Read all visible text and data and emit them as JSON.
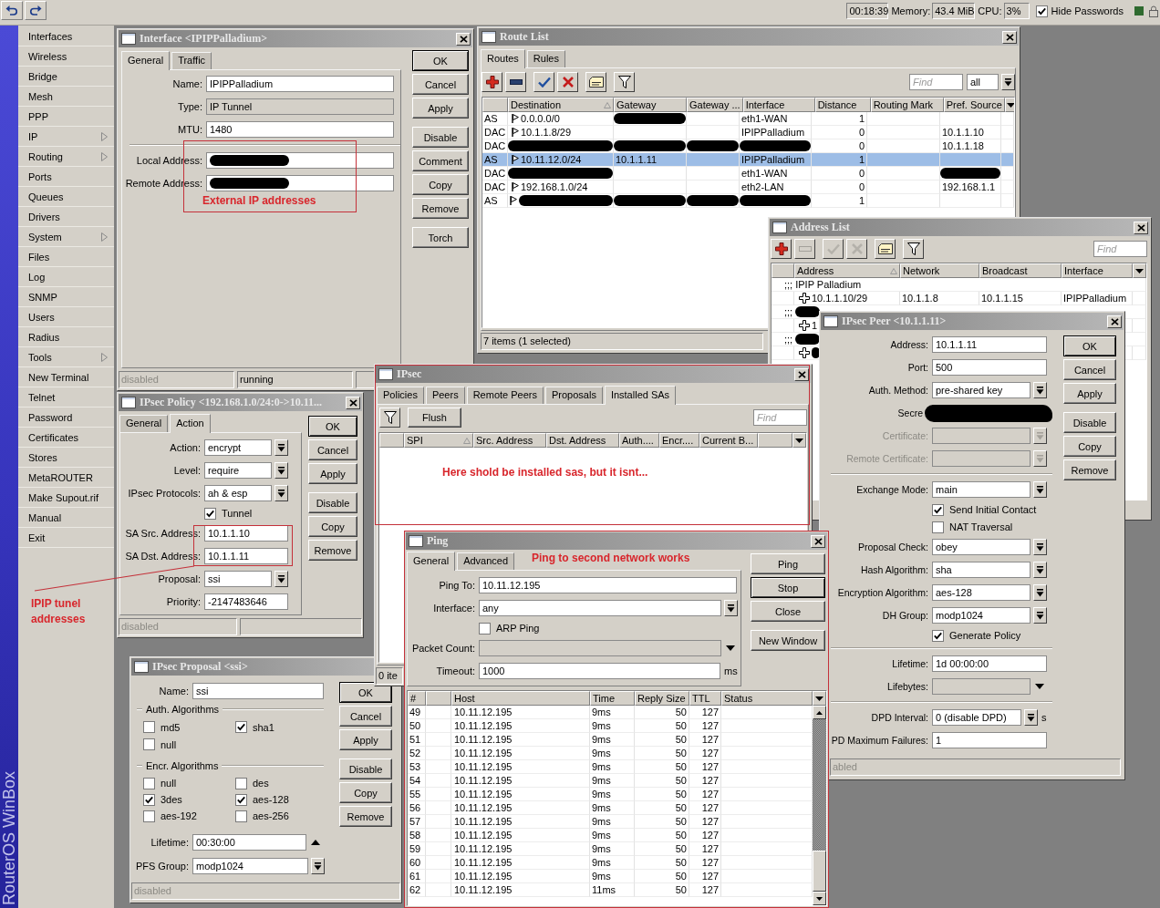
{
  "top_bar": {
    "clock": "00:18:39",
    "memory_label": "Memory:",
    "memory": "43.4 MiB",
    "cpu_label": "CPU:",
    "cpu": "3%",
    "hide_passwords": {
      "label": "Hide Passwords",
      "checked": true
    }
  },
  "sidebar": {
    "brand": "RouterOS WinBox",
    "items": [
      {
        "label": "Interfaces",
        "submenu": false
      },
      {
        "label": "Wireless",
        "submenu": false
      },
      {
        "label": "Bridge",
        "submenu": false
      },
      {
        "label": "Mesh",
        "submenu": false
      },
      {
        "label": "PPP",
        "submenu": false
      },
      {
        "label": "IP",
        "submenu": true
      },
      {
        "label": "Routing",
        "submenu": true
      },
      {
        "label": "Ports",
        "submenu": false
      },
      {
        "label": "Queues",
        "submenu": false
      },
      {
        "label": "Drivers",
        "submenu": false
      },
      {
        "label": "System",
        "submenu": true
      },
      {
        "label": "Files",
        "submenu": false
      },
      {
        "label": "Log",
        "submenu": false
      },
      {
        "label": "SNMP",
        "submenu": false
      },
      {
        "label": "Users",
        "submenu": false
      },
      {
        "label": "Radius",
        "submenu": false
      },
      {
        "label": "Tools",
        "submenu": true
      },
      {
        "label": "New Terminal",
        "submenu": false
      },
      {
        "label": "Telnet",
        "submenu": false
      },
      {
        "label": "Password",
        "submenu": false
      },
      {
        "label": "Certificates",
        "submenu": false
      },
      {
        "label": "Stores",
        "submenu": false
      },
      {
        "label": "MetaROUTER",
        "submenu": false
      },
      {
        "label": "Make Supout.rif",
        "submenu": false
      },
      {
        "label": "Manual",
        "submenu": false
      },
      {
        "label": "Exit",
        "submenu": false
      }
    ]
  },
  "interface_window": {
    "title": "Interface <IPIPPalladium>",
    "tabs": [
      {
        "label": "General",
        "selected": true
      },
      {
        "label": "Traffic",
        "selected": false
      }
    ],
    "fields": [
      {
        "kind": "text",
        "label": "Name:",
        "value": "IPIPPalladium"
      },
      {
        "kind": "readonly",
        "label": "Type:",
        "value": "IP Tunnel"
      },
      {
        "kind": "text",
        "label": "MTU:",
        "value": "1480"
      },
      {
        "kind": "separator"
      },
      {
        "kind": "redacted",
        "label": "Local Address:"
      },
      {
        "kind": "redacted",
        "label": "Remote Address:"
      }
    ],
    "buttons": [
      [
        {
          "label": "OK",
          "default": true
        },
        {
          "label": "Cancel",
          "default": false
        },
        {
          "label": "Apply",
          "default": false
        }
      ],
      [
        {
          "label": "Disable",
          "default": false
        },
        {
          "label": "Comment",
          "default": false
        },
        {
          "label": "Copy",
          "default": false
        },
        {
          "label": "Remove",
          "default": false
        }
      ],
      [
        {
          "label": "Torch",
          "default": false
        }
      ]
    ],
    "status_bar": [
      {
        "text": "disabled",
        "greyed": true
      },
      {
        "text": "running",
        "greyed": false
      }
    ]
  },
  "route_list_window": {
    "title": "Route List",
    "tabs": [
      {
        "label": "Routes",
        "selected": true
      },
      {
        "label": "Rules",
        "selected": false
      }
    ],
    "toolbar": [
      [
        {
          "kind": "add",
          "disabled": false
        },
        {
          "kind": "remove",
          "disabled": false
        }
      ],
      [
        {
          "kind": "enable",
          "disabled": false
        },
        {
          "kind": "disable",
          "disabled": false
        }
      ],
      [
        {
          "kind": "comment",
          "disabled": false
        }
      ],
      [
        {
          "kind": "filter",
          "disabled": false
        }
      ]
    ],
    "find": {
      "placeholder": "Find"
    },
    "scope": {
      "value": "all"
    },
    "table": {
      "columns": [
        {
          "label": "Destination",
          "sorted": true
        },
        {
          "label": "Gateway",
          "sorted": false
        },
        {
          "label": "Gateway ...",
          "sorted": false
        },
        {
          "label": "Interface",
          "sorted": false
        },
        {
          "label": "Distance",
          "sorted": false
        },
        {
          "label": "Routing Mark",
          "sorted": false
        },
        {
          "label": "Pref. Source",
          "sorted": false
        }
      ],
      "rows": [
        {
          "flags": "AS",
          "icon": true,
          "destination": "0.0.0.0/0",
          "interface": "eth1-WAN",
          "distance": "1",
          "redacted": {
            "gateway": true
          },
          "selected": false
        },
        {
          "flags": "DAC",
          "icon": true,
          "destination": "10.1.1.8/29",
          "interface": "IPIPPalladium",
          "distance": "0",
          "pref_source": "10.1.1.10",
          "selected": false
        },
        {
          "flags": "DAC",
          "icon": false,
          "distance": "0",
          "pref_source": "10.1.1.18",
          "redacted": {
            "destination": true,
            "gateway": true,
            "gateway_2": true,
            "interface": true
          },
          "selected": false
        },
        {
          "flags": "AS",
          "icon": true,
          "destination": "10.11.12.0/24",
          "gateway": "10.1.1.11",
          "interface": "IPIPPalladium",
          "distance": "1",
          "selected": true
        },
        {
          "flags": "DAC",
          "icon": false,
          "interface": "eth1-WAN",
          "distance": "0",
          "redacted": {
            "destination": true,
            "pref_source": true
          },
          "selected": false
        },
        {
          "flags": "DAC",
          "icon": true,
          "destination": "192.168.1.0/24",
          "interface": "eth2-LAN",
          "distance": "0",
          "pref_source": "192.168.1.1",
          "selected": false
        },
        {
          "flags": "AS",
          "icon": true,
          "distance": "1",
          "redacted": {
            "destination": true,
            "gateway": true,
            "gateway_2": true,
            "interface": true
          },
          "selected": false
        }
      ]
    },
    "status_bar": [
      {
        "text": "7 items (1 selected)",
        "greyed": false
      }
    ]
  },
  "address_list_window": {
    "title": "Address List",
    "toolbar": [
      [
        {
          "kind": "add",
          "disabled": false
        },
        {
          "kind": "remove",
          "disabled": true
        }
      ],
      [
        {
          "kind": "enable",
          "disabled": true
        },
        {
          "kind": "disable",
          "disabled": true
        }
      ],
      [
        {
          "kind": "comment",
          "disabled": false
        }
      ],
      [
        {
          "kind": "filter",
          "disabled": false
        }
      ]
    ],
    "find": {
      "placeholder": "Find"
    },
    "table": {
      "columns": [
        {
          "label": "Address",
          "sorted": true
        },
        {
          "label": "Network",
          "sorted": false
        },
        {
          "label": "Broadcast",
          "sorted": false
        },
        {
          "label": "Interface",
          "sorted": false
        }
      ],
      "rows": [
        {
          "kind": "comment",
          "text": ";;; IPIP Palladium",
          "redacted": false
        },
        {
          "kind": "address",
          "address": "10.1.1.10/29",
          "network": "10.1.1.8",
          "broadcast": "10.1.1.15",
          "interface": "IPIPPalladium",
          "redacted": false
        },
        {
          "kind": "comment",
          "text": ";;;",
          "redacted": true
        },
        {
          "kind": "address",
          "address": "1",
          "redacted": false
        },
        {
          "kind": "comment",
          "text": ";;;",
          "redacted": true
        },
        {
          "kind": "address",
          "redacted": true
        }
      ]
    }
  },
  "ipsec_peer_window": {
    "title": "IPsec Peer <10.1.1.11>",
    "fields": [
      {
        "kind": "text",
        "label": "Address:",
        "value": "10.1.1.11"
      },
      {
        "kind": "text",
        "label": "Port:",
        "value": "500"
      },
      {
        "kind": "combo",
        "label": "Auth. Method:",
        "value": "pre-shared key",
        "disabled": false
      },
      {
        "kind": "covered",
        "label": "Secre"
      },
      {
        "kind": "combo",
        "label": "Certificate:",
        "disabled": true
      },
      {
        "kind": "combo",
        "label": "Remote Certificate:",
        "disabled": true
      },
      {
        "kind": "separator"
      },
      {
        "kind": "combo",
        "label": "Exchange Mode:",
        "value": "main",
        "disabled": false
      },
      {
        "kind": "checkbox",
        "label": "Send Initial Contact",
        "checked": true
      },
      {
        "kind": "checkbox",
        "label": "NAT Traversal",
        "checked": false
      },
      {
        "kind": "combo",
        "label": "Proposal Check:",
        "value": "obey",
        "disabled": false
      },
      {
        "kind": "combo",
        "label": "Hash Algorithm:",
        "value": "sha",
        "disabled": false
      },
      {
        "kind": "combo",
        "label": "Encryption Algorithm:",
        "value": "aes-128",
        "disabled": false
      },
      {
        "kind": "combo",
        "label": "DH Group:",
        "value": "modp1024",
        "disabled": false
      },
      {
        "kind": "checkbox",
        "label": "Generate Policy",
        "checked": true
      },
      {
        "kind": "separator"
      },
      {
        "kind": "text",
        "label": "Lifetime:",
        "value": "1d 00:00:00"
      },
      {
        "kind": "optional",
        "label": "Lifebytes:",
        "expanded": false
      },
      {
        "kind": "separator"
      },
      {
        "kind": "combo",
        "label": "DPD Interval:",
        "value": "0 (disable DPD)",
        "unit": "s",
        "disabled": false
      },
      {
        "kind": "text",
        "label": "PD Maximum Failures:",
        "value": "1"
      }
    ],
    "buttons": [
      [
        {
          "label": "OK",
          "default": true
        },
        {
          "label": "Cancel",
          "default": false
        },
        {
          "label": "Apply",
          "default": false
        }
      ],
      [
        {
          "label": "Disable",
          "default": false
        },
        {
          "label": "Copy",
          "default": false
        },
        {
          "label": "Remove",
          "default": false
        }
      ]
    ],
    "status_bar": [
      {
        "text": "abled",
        "greyed": true
      }
    ]
  },
  "ipsec_policy_window": {
    "title": "IPsec Policy <192.168.1.0/24:0->10.11...",
    "tabs": [
      {
        "label": "General",
        "selected": false
      },
      {
        "label": "Action",
        "selected": true
      }
    ],
    "fields": [
      {
        "kind": "combo",
        "label": "Action:",
        "value": "encrypt",
        "disabled": false
      },
      {
        "kind": "combo",
        "label": "Level:",
        "value": "require",
        "disabled": false
      },
      {
        "kind": "combo",
        "label": "IPsec Protocols:",
        "value": "ah & esp",
        "disabled": false
      },
      {
        "kind": "checkbox",
        "label": "Tunnel",
        "checked": true
      },
      {
        "kind": "text",
        "label": "SA Src. Address:",
        "value": "10.1.1.10"
      },
      {
        "kind": "text",
        "label": "SA Dst. Address:",
        "value": "10.1.1.11"
      },
      {
        "kind": "combo",
        "label": "Proposal:",
        "value": "ssi",
        "disabled": false
      },
      {
        "kind": "text",
        "label": "Priority:",
        "value": "-2147483646"
      }
    ],
    "buttons": [
      [
        {
          "label": "OK",
          "default": true
        },
        {
          "label": "Cancel",
          "default": false
        },
        {
          "label": "Apply",
          "default": false
        }
      ],
      [
        {
          "label": "Disable",
          "default": false
        },
        {
          "label": "Copy",
          "default": false
        },
        {
          "label": "Remove",
          "default": false
        }
      ]
    ],
    "status_bar": [
      {
        "text": "disabled",
        "greyed": true
      }
    ]
  },
  "ipsec_proposal_window": {
    "title": "IPsec Proposal <ssi>",
    "fields": [
      {
        "kind": "text",
        "label": "Name:",
        "value": "ssi"
      }
    ],
    "auth_algorithms": {
      "label": "Auth. Algorithms",
      "options": [
        {
          "label": "md5",
          "checked": false
        },
        {
          "label": "sha1",
          "checked": true
        },
        {
          "label": "null",
          "checked": false
        }
      ]
    },
    "encr_algorithms": {
      "label": "Encr. Algorithms",
      "options": [
        {
          "label": "null",
          "checked": false
        },
        {
          "label": "des",
          "checked": false
        },
        {
          "label": "3des",
          "checked": true
        },
        {
          "label": "aes-128",
          "checked": true
        },
        {
          "label": "aes-192",
          "checked": false
        },
        {
          "label": "aes-256",
          "checked": false
        }
      ]
    },
    "lower_fields": [
      {
        "kind": "optional",
        "label": "Lifetime:",
        "value": "00:30:00",
        "expanded": true
      },
      {
        "kind": "combo",
        "label": "PFS Group:",
        "value": "modp1024",
        "disabled": false
      }
    ],
    "buttons": [
      [
        {
          "label": "OK",
          "default": true
        },
        {
          "label": "Cancel",
          "default": false
        },
        {
          "label": "Apply",
          "default": false
        }
      ],
      [
        {
          "label": "Disable",
          "default": false
        },
        {
          "label": "Copy",
          "default": false
        },
        {
          "label": "Remove",
          "default": false
        }
      ]
    ],
    "status_bar": [
      {
        "text": "disabled",
        "greyed": true
      }
    ]
  },
  "ipsec_window": {
    "title": "IPsec",
    "tabs": [
      {
        "label": "Policies",
        "selected": false
      },
      {
        "label": "Peers",
        "selected": false
      },
      {
        "label": "Remote Peers",
        "selected": false
      },
      {
        "label": "Proposals",
        "selected": false
      },
      {
        "label": "Installed SAs",
        "selected": true
      }
    ],
    "toolbar": [
      [
        {
          "kind": "filter",
          "disabled": false
        }
      ]
    ],
    "actions": [
      {
        "label": "Flush"
      }
    ],
    "find": {
      "placeholder": "Find"
    },
    "table": {
      "columns": [
        {
          "label": "SPI",
          "sorted": true
        },
        {
          "label": "Src. Address",
          "sorted": false
        },
        {
          "label": "Dst. Address",
          "sorted": false
        },
        {
          "label": "Auth....",
          "sorted": false
        },
        {
          "label": "Encr....",
          "sorted": false
        },
        {
          "label": "Current B...",
          "sorted": false
        }
      ]
    },
    "status_bar": [
      {
        "text": "0 ite",
        "greyed": false
      }
    ]
  },
  "ping_window": {
    "title": "Ping",
    "tabs": [
      {
        "label": "General",
        "selected": true
      },
      {
        "label": "Advanced",
        "selected": false
      }
    ],
    "fields": [
      {
        "kind": "text",
        "label": "Ping To:",
        "value": "10.11.12.195"
      },
      {
        "kind": "combo",
        "label": "Interface:",
        "value": "any",
        "disabled": false
      },
      {
        "kind": "checkbox",
        "label": "ARP Ping",
        "checked": false
      },
      {
        "kind": "optional",
        "label": "Packet Count:",
        "expanded": false
      },
      {
        "kind": "text",
        "label": "Timeout:",
        "value": "1000",
        "unit": "ms"
      }
    ],
    "buttons": [
      [
        {
          "label": "Ping",
          "default": false
        },
        {
          "label": "Stop",
          "default": true
        },
        {
          "label": "Close",
          "default": false
        }
      ],
      [
        {
          "label": "New Window",
          "default": false
        }
      ]
    ],
    "table": {
      "columns": [
        {
          "label": "#"
        },
        {
          "label": "Host"
        },
        {
          "label": "Time"
        },
        {
          "label": "Reply Size"
        },
        {
          "label": "TTL"
        },
        {
          "label": "Status"
        }
      ],
      "rows": [
        {
          "seq": "49",
          "host": "10.11.12.195",
          "time": "9ms",
          "reply_size": "50",
          "ttl": "127"
        },
        {
          "seq": "50",
          "host": "10.11.12.195",
          "time": "9ms",
          "reply_size": "50",
          "ttl": "127"
        },
        {
          "seq": "51",
          "host": "10.11.12.195",
          "time": "9ms",
          "reply_size": "50",
          "ttl": "127"
        },
        {
          "seq": "52",
          "host": "10.11.12.195",
          "time": "9ms",
          "reply_size": "50",
          "ttl": "127"
        },
        {
          "seq": "53",
          "host": "10.11.12.195",
          "time": "9ms",
          "reply_size": "50",
          "ttl": "127"
        },
        {
          "seq": "54",
          "host": "10.11.12.195",
          "time": "9ms",
          "reply_size": "50",
          "ttl": "127"
        },
        {
          "seq": "55",
          "host": "10.11.12.195",
          "time": "9ms",
          "reply_size": "50",
          "ttl": "127"
        },
        {
          "seq": "56",
          "host": "10.11.12.195",
          "time": "9ms",
          "reply_size": "50",
          "ttl": "127"
        },
        {
          "seq": "57",
          "host": "10.11.12.195",
          "time": "9ms",
          "reply_size": "50",
          "ttl": "127"
        },
        {
          "seq": "58",
          "host": "10.11.12.195",
          "time": "9ms",
          "reply_size": "50",
          "ttl": "127"
        },
        {
          "seq": "59",
          "host": "10.11.12.195",
          "time": "9ms",
          "reply_size": "50",
          "ttl": "127"
        },
        {
          "seq": "60",
          "host": "10.11.12.195",
          "time": "9ms",
          "reply_size": "50",
          "ttl": "127"
        },
        {
          "seq": "61",
          "host": "10.11.12.195",
          "time": "9ms",
          "reply_size": "50",
          "ttl": "127"
        },
        {
          "seq": "62",
          "host": "10.11.12.195",
          "time": "11ms",
          "reply_size": "50",
          "ttl": "127"
        }
      ]
    }
  },
  "annotations": [
    {
      "text": "External IP addresses"
    },
    {
      "text": "Here shold be installed sas, but it isnt..."
    },
    {
      "text": "Ping to second network works"
    },
    {
      "text": "IPIP tunel addresses"
    }
  ]
}
